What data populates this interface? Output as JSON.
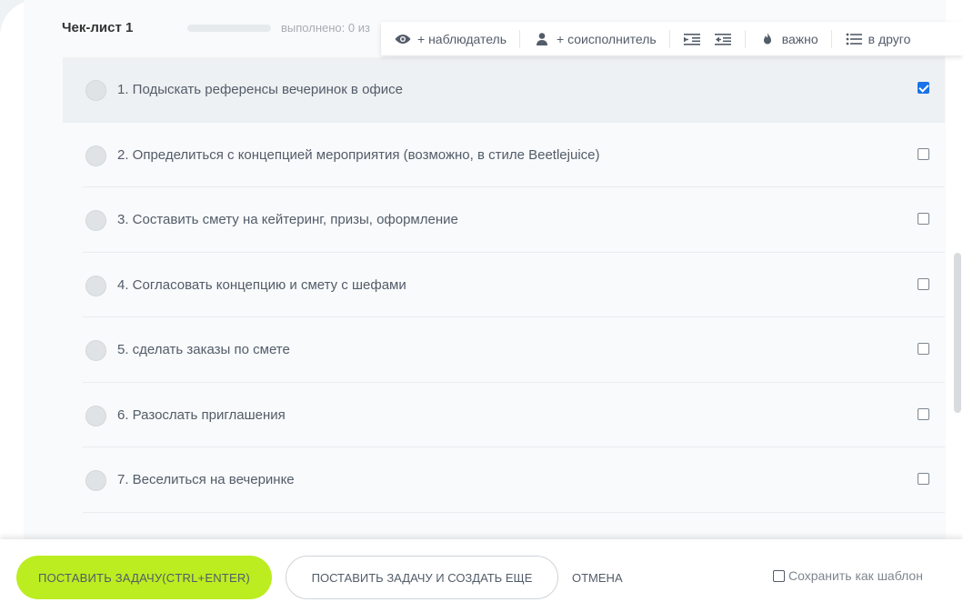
{
  "checklist": {
    "title": "Чек-лист 1",
    "progress_text": "выполнено: 0 из",
    "progress_fraction": 0
  },
  "toolbar": {
    "observer": "+ наблюдатель",
    "coexecutor": "+ соисполнитель",
    "important": "важно",
    "to_other": "в друго"
  },
  "items": [
    {
      "text": "1. Подыскать референсы вечеринок в офисе",
      "checked": true
    },
    {
      "text": "2. Определиться с концепцией мероприятия (возможно, в стиле Beetlejuice)",
      "checked": false
    },
    {
      "text": "3. Составить смету на кейтеринг, призы, оформление",
      "checked": false
    },
    {
      "text": "4. Согласовать концепцию и смету с шефами",
      "checked": false
    },
    {
      "text": "5. сделать заказы по смете",
      "checked": false
    },
    {
      "text": "6. Разослать приглашения",
      "checked": false
    },
    {
      "text": "7. Веселиться на вечеринке",
      "checked": false
    }
  ],
  "footer": {
    "primary": "ПОСТАВИТЬ ЗАДАЧУ(CTRL+ENTER)",
    "secondary": "ПОСТАВИТЬ ЗАДАЧУ И СОЗДАТЬ ЕЩЕ",
    "cancel": "ОТМЕНА",
    "save_template": "Сохранить как шаблон"
  },
  "colors": {
    "accent_green": "#bbed21",
    "checkbox_blue": "#1a73e8"
  },
  "icons": [
    "eye-icon",
    "person-icon",
    "indent-icon",
    "outdent-icon",
    "fire-icon",
    "list-icon"
  ]
}
